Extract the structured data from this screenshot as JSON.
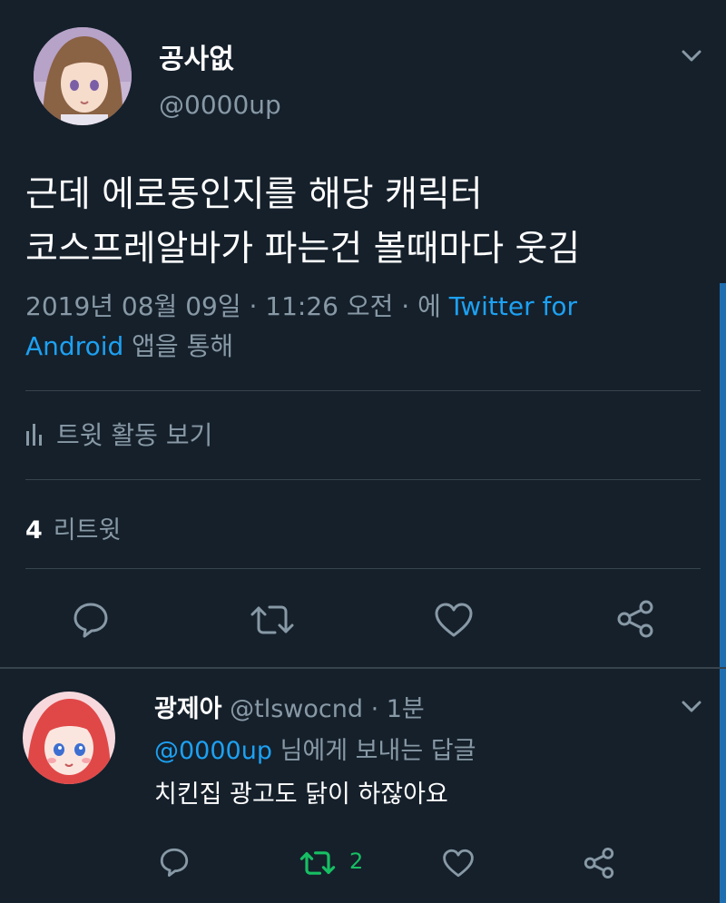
{
  "tweet": {
    "author_name": "공사없",
    "author_handle": "@0000up",
    "text_lines": [
      "근데 에로동인지를 해당 캐릭터",
      "코스프레알바가 파는건 볼때마다 웃김"
    ],
    "date": "2019년 08월 09일 · 11:26 오전 · 에",
    "client_line1": "Twitter for",
    "client_line2": "Android",
    "client_suffix": "앱을 통해",
    "activity_label": "트윗 활동 보기",
    "retweet_count": "4",
    "retweet_label": "리트윗",
    "icons": [
      "reply-icon",
      "retweet-icon",
      "like-icon",
      "share-icon",
      "chevron-down-icon",
      "activity-bars-icon"
    ]
  },
  "reply": {
    "author_name": "광제아",
    "author_handle": "@tlswocnd",
    "time": "· 1분",
    "reply_to_mention": "@0000up",
    "reply_to_suffix": "님에게 보내는 답글",
    "text": "치킨집 광고도 닭이 하잖아요",
    "retweet_count": "2",
    "retweeted": true
  },
  "colors": {
    "background": "#15202b",
    "divider": "#38444d",
    "secondary_text": "#8899a6",
    "link": "#1da1f2",
    "retweet_active": "#17bf63"
  }
}
